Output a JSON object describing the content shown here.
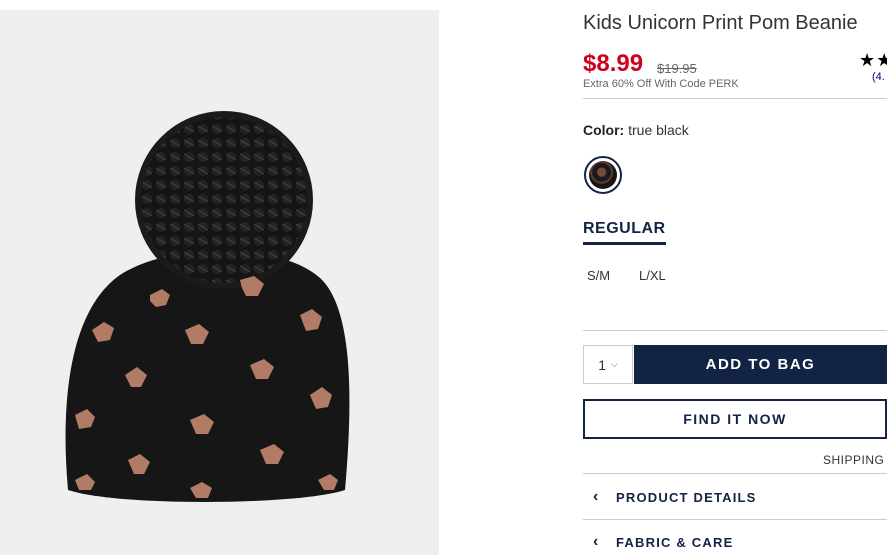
{
  "product": {
    "title": "Kids Unicorn Print Pom Beanie",
    "price": "$8.99",
    "original_price": "$19.95",
    "promo": "Extra 60% Off With Code PERK",
    "rating_stars": "★★",
    "rating_count": "(4."
  },
  "color": {
    "label": "Color:",
    "value": "true black",
    "swatch_icon": "true-black-swatch"
  },
  "fit": {
    "tab_label": "REGULAR",
    "sizes": [
      "S/M",
      "L/XL"
    ]
  },
  "purchase": {
    "quantity": "1",
    "add_to_bag": "ADD TO BAG",
    "find_it_now": "FIND IT NOW",
    "shipping": "SHIPPING"
  },
  "accordions": [
    {
      "label": "PRODUCT DETAILS",
      "icon": "chevron-left-icon"
    },
    {
      "label": "FABRIC & CARE",
      "icon": "chevron-left-icon"
    }
  ],
  "colors": {
    "sale_red": "#d0021b",
    "navy": "#122344",
    "image_bg": "#efefef"
  }
}
